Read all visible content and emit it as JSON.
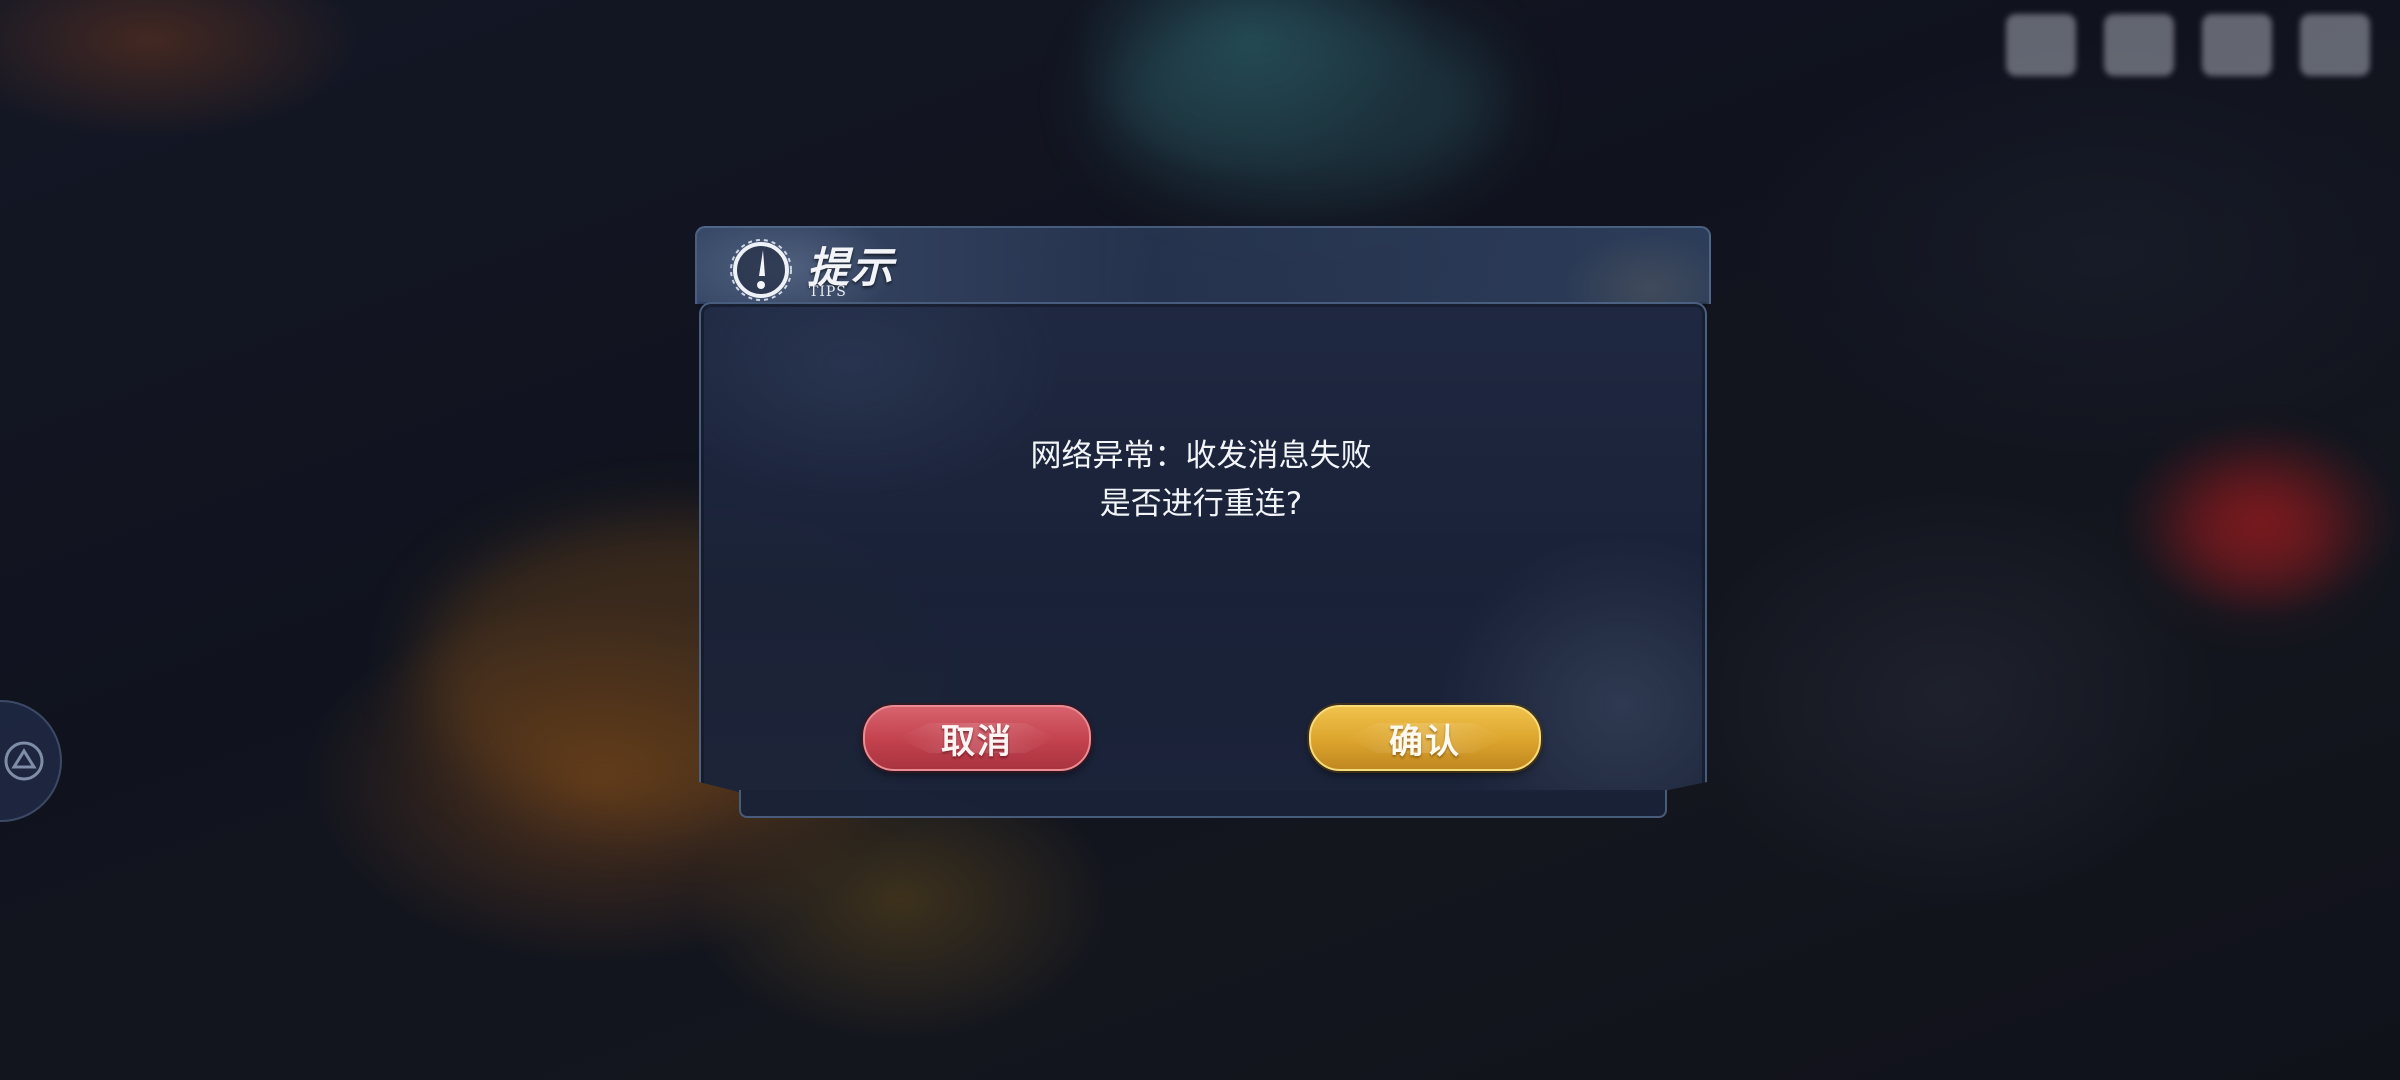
{
  "dialog": {
    "title": "提示",
    "title_sub": "TIPS",
    "icon": "exclamation-emblem-icon",
    "message_lines": [
      "网络异常：收发消息失败",
      "是否进行重连?"
    ],
    "cancel_label": "取消",
    "confirm_label": "确认"
  },
  "hud": {
    "side_icon": "gamepad-icon",
    "top_icons": [
      "hud-icon-1",
      "hud-icon-2",
      "hud-icon-3",
      "hud-icon-4"
    ]
  },
  "colors": {
    "cancel": "#c2414d",
    "confirm": "#dca42c",
    "panel": "#1f2a42"
  }
}
